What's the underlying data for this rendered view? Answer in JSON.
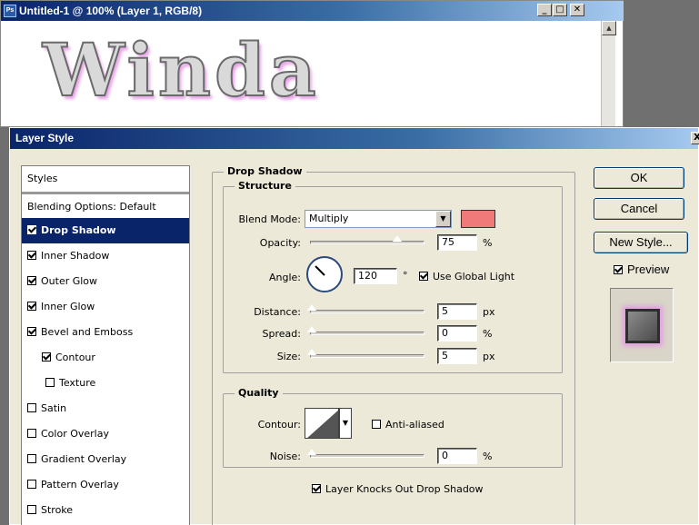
{
  "document": {
    "title": "Untitled-1 @ 100% (Layer 1, RGB/8)",
    "icon_text": "Ps",
    "canvas_text": "Winda",
    "buttons": {
      "minimize": "_",
      "maximize": "□",
      "close": "✕"
    }
  },
  "dialog": {
    "title": "Layer Style",
    "close": "X"
  },
  "styles": {
    "header": "Styles",
    "blending": "Blending Options: Default",
    "items": [
      {
        "label": "Drop Shadow",
        "checked": true,
        "active": true
      },
      {
        "label": "Inner Shadow",
        "checked": true
      },
      {
        "label": "Outer Glow",
        "checked": true
      },
      {
        "label": "Inner Glow",
        "checked": true
      },
      {
        "label": "Bevel and Emboss",
        "checked": true
      },
      {
        "label": "Contour",
        "checked": true
      },
      {
        "label": "Texture",
        "checked": false
      },
      {
        "label": "Satin",
        "checked": false
      },
      {
        "label": "Color Overlay",
        "checked": false
      },
      {
        "label": "Gradient Overlay",
        "checked": false
      },
      {
        "label": "Pattern Overlay",
        "checked": false
      },
      {
        "label": "Stroke",
        "checked": false
      }
    ]
  },
  "drop_shadow": {
    "section": "Drop Shadow",
    "structure": {
      "title": "Structure",
      "blend_mode_label": "Blend Mode:",
      "blend_mode_value": "Multiply",
      "shadow_color": "#f07a7a",
      "opacity_label": "Opacity:",
      "opacity_value": "75",
      "opacity_unit": "%",
      "opacity_fraction": 0.75,
      "angle_label": "Angle:",
      "angle_value": "120",
      "angle_unit": "°",
      "use_global_light": "Use Global Light",
      "distance_label": "Distance:",
      "distance_value": "5",
      "distance_unit": "px",
      "spread_label": "Spread:",
      "spread_value": "0",
      "spread_unit": "%",
      "size_label": "Size:",
      "size_value": "5",
      "size_unit": "px"
    },
    "quality": {
      "title": "Quality",
      "contour_label": "Contour:",
      "anti_aliased": "Anti-aliased",
      "noise_label": "Noise:",
      "noise_value": "0",
      "noise_unit": "%"
    },
    "knockout": "Layer Knocks Out Drop Shadow"
  },
  "buttons": {
    "ok": "OK",
    "cancel": "Cancel",
    "new_style": "New Style...",
    "preview": "Preview"
  }
}
